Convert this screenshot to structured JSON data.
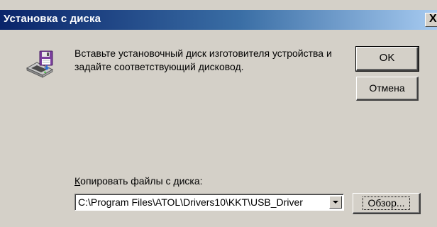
{
  "window": {
    "title": "Установка с диска",
    "close_glyph": "X",
    "close_icon": "close-icon"
  },
  "icon": "floppy-disk-drive-icon",
  "message": "Вставьте установочный диск изготовителя устройства и задайте соответствующий дисковод.",
  "buttons": {
    "ok": "OK",
    "cancel": "Отмена",
    "browse": "Обзор..."
  },
  "copy_from": {
    "label": "Копировать файлы с диска:",
    "value": "C:\\Program Files\\ATOL\\Drivers10\\KKT\\USB_Driver"
  }
}
